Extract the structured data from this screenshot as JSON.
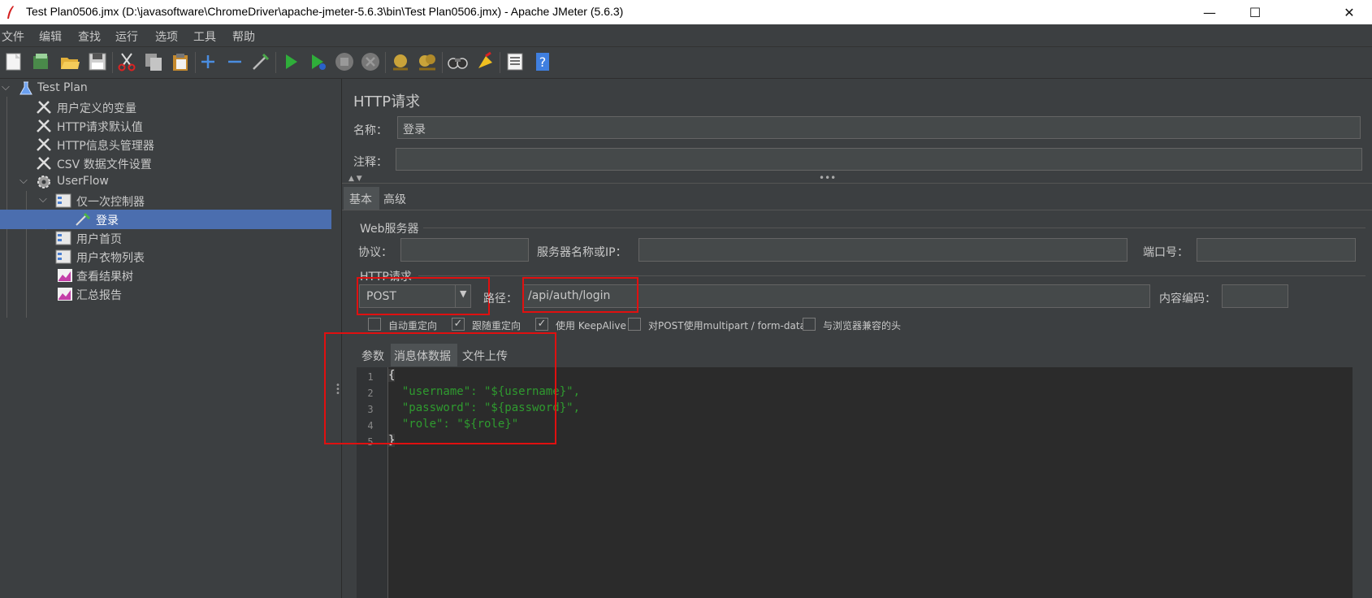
{
  "window": {
    "title": "Test Plan0506.jmx (D:\\javasoftware\\ChromeDriver\\apache-jmeter-5.6.3\\bin\\Test Plan0506.jmx) - Apache JMeter (5.6.3)",
    "minimize": "—",
    "maximize": "☐",
    "close": "✕"
  },
  "menu": [
    "文件",
    "编辑",
    "查找",
    "运行",
    "选项",
    "工具",
    "帮助"
  ],
  "toolbar_icons": [
    "new-icon",
    "templates-icon",
    "open-icon",
    "save-icon",
    "cut-icon",
    "copy-icon",
    "paste-icon",
    "expand-icon",
    "collapse-icon",
    "toggle-icon",
    "start-icon",
    "start-no-pause-icon",
    "stop-icon",
    "shutdown-icon",
    "clear-icon",
    "clear-all-icon",
    "search-icon",
    "reset-search-icon",
    "function-helper-icon",
    "help-icon"
  ],
  "tree": {
    "root": "Test Plan",
    "items": [
      {
        "label": "用户定义的变量",
        "icon": "wrench-icon"
      },
      {
        "label": "HTTP请求默认值",
        "icon": "wrench-icon"
      },
      {
        "label": "HTTP信息头管理器",
        "icon": "wrench-icon"
      },
      {
        "label": "CSV 数据文件设置",
        "icon": "wrench-icon"
      },
      {
        "label": "UserFlow",
        "icon": "gear-icon"
      },
      {
        "label": "仅一次控制器",
        "icon": "controller-icon"
      },
      {
        "label": "登录",
        "icon": "sampler-icon"
      },
      {
        "label": "用户首页",
        "icon": "controller-icon"
      },
      {
        "label": "用户衣物列表",
        "icon": "controller-icon"
      },
      {
        "label": "查看结果树",
        "icon": "chart-icon"
      },
      {
        "label": "汇总报告",
        "icon": "chart-icon"
      }
    ]
  },
  "panel": {
    "title": "HTTP请求",
    "name_label": "名称：",
    "name_value": "登录",
    "comment_label": "注释：",
    "comment_value": "",
    "tabs": [
      "基本",
      "高级"
    ],
    "web_server_section": "Web服务器",
    "protocol_label": "协议：",
    "protocol_value": "",
    "server_label": "服务器名称或IP：",
    "server_value": "",
    "port_label": "端口号：",
    "port_value": "",
    "http_section": "HTTP请求",
    "method": "POST",
    "path_label": "路径：",
    "path_value": "/api/auth/login",
    "encoding_label": "内容编码：",
    "encoding_value": "",
    "checkboxes": [
      {
        "label": "自动重定向",
        "checked": false
      },
      {
        "label": "跟随重定向",
        "checked": true
      },
      {
        "label": "使用 KeepAlive",
        "checked": true
      },
      {
        "label": "对POST使用multipart / form-data",
        "checked": false
      },
      {
        "label": "与浏览器兼容的头",
        "checked": false
      }
    ],
    "body_tabs": [
      "参数",
      "消息体数据",
      "文件上传"
    ],
    "code_lines": [
      "{",
      "  \"username\": \"${username}\",",
      "  \"password\": \"${password}\",",
      "  \"role\": \"${role}\"",
      "}"
    ],
    "line_numbers": [
      "1",
      "2",
      "3",
      "4",
      "5"
    ]
  },
  "colors": {
    "background": "#3c3f41",
    "selection": "#4b6eaf",
    "highlight_box": "#e01010",
    "json_string": "#2f9b2f"
  }
}
